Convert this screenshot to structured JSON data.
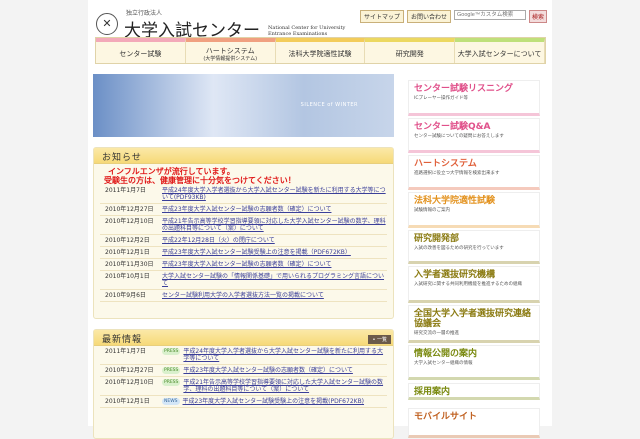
{
  "header": {
    "org_small": "独立行政法人",
    "org": "大学入試センター",
    "org_en": "National Center for University Entrance Examinations",
    "links": [
      "サイトマップ",
      "お問い合わせ"
    ],
    "search_placeholder": "Google™カスタム検索",
    "search_button": "検索"
  },
  "nav": [
    {
      "label": "センター試験",
      "color": "#f3a9b9"
    },
    {
      "label": "ハートシステム",
      "sub": "(大学情報提供システム)",
      "color": "#f0a080"
    },
    {
      "label": "法科大学院適性試験",
      "color": "#f3cc5a"
    },
    {
      "label": "研究開発",
      "color": "#ecd860"
    },
    {
      "label": "大学入試センターについて",
      "color": "#bfe07a"
    }
  ],
  "banner": {
    "caption": "SILENCE of WINTER"
  },
  "notices": {
    "title": "お知らせ",
    "alert": [
      "インフルエンザが流行しています。",
      "受験生の方は、健康管理に十分気をつけてください！"
    ],
    "items": [
      {
        "date": "2011年1月7日",
        "text": "平成24年度大学入学者選抜から大学入試センター試験を新たに利用する大学等について(PDF93KB)"
      },
      {
        "date": "2010年12月27日",
        "text": "平成23年度大学入試センター試験の志願者数（確定）について"
      },
      {
        "date": "2010年12月10日",
        "text": "平成21年告示高等学校学習指導要領に対応した大学入試センター試験の数学、理科の出題科目等について（案）について"
      },
      {
        "date": "2010年12月2日",
        "text": "平成22年12月28日（火）の閉庁について"
      },
      {
        "date": "2010年12月1日",
        "text": "平成23年度大学入試センター試験受験上の注意を掲載（PDF672KB）"
      },
      {
        "date": "2010年11月30日",
        "text": "平成23年度大学入試センター試験の志願者数（確定）について"
      },
      {
        "date": "2010年10月1日",
        "text": "大学入試センター試験の「情報関係基礎」で用いられるプログラミング言語について"
      },
      {
        "date": "2010年9月6日",
        "text": "センター試験利用大学の入学者選抜方法一覧の掲載について"
      }
    ]
  },
  "latest": {
    "title": "最新情報",
    "more": "• 一覧",
    "items": [
      {
        "date": "2011年1月7日",
        "tag": "PRESS",
        "text": "平成24年度大学入学者選抜から大学入試センター試験を新たに利用する大学等について"
      },
      {
        "date": "2010年12月27日",
        "tag": "PRESS",
        "text": "平成23年度大学入試センター試験の志願者数（確定）について"
      },
      {
        "date": "2010年12月10日",
        "tag": "PRESS",
        "text": "平成21年告示高等学校学習指導要領に対応した大学入試センター試験の数学、理科の出題科目等について（案）について"
      },
      {
        "date": "2010年12月1日",
        "tag": "NEWS",
        "text": "平成23年度大学入試センター試験受験上の注意を掲載(PDF672KB)"
      }
    ]
  },
  "side": [
    {
      "title": "センター試験リスニング",
      "desc": "ICプレーヤー操作ガイド等",
      "color": "#e0508a"
    },
    {
      "title": "センター試験Q&A",
      "desc": "センター試験についての疑問にお答えします",
      "color": "#e0508a"
    },
    {
      "title": "ハートシステム",
      "desc": "進路選択に役立つ大学情報を検索出来ます",
      "color": "#e0603a"
    },
    {
      "title": "法科大学院適性試験",
      "desc": "試験情報のご案内",
      "color": "#e39320"
    },
    {
      "title": "研究開発部",
      "desc": "入試の改善を図るための研究を行っています",
      "color": "#8a7a10"
    },
    {
      "title": "入学者選抜研究機構",
      "desc": "入試研究に関する共同利用機能を推進するための組織",
      "color": "#8a7a10"
    },
    {
      "title": "全国大学入学者選抜研究連絡協議会",
      "desc": "研究交流の一層の推進",
      "color": "#8a7a10"
    },
    {
      "title": "情報公開の案内",
      "desc": "大学入試センター組織の情報",
      "color": "#7a8a10"
    },
    {
      "title": "採用案内",
      "desc": "",
      "color": "#7a8a10"
    },
    {
      "title": "モバイルサイト",
      "desc": "",
      "color": "#c06020"
    }
  ]
}
